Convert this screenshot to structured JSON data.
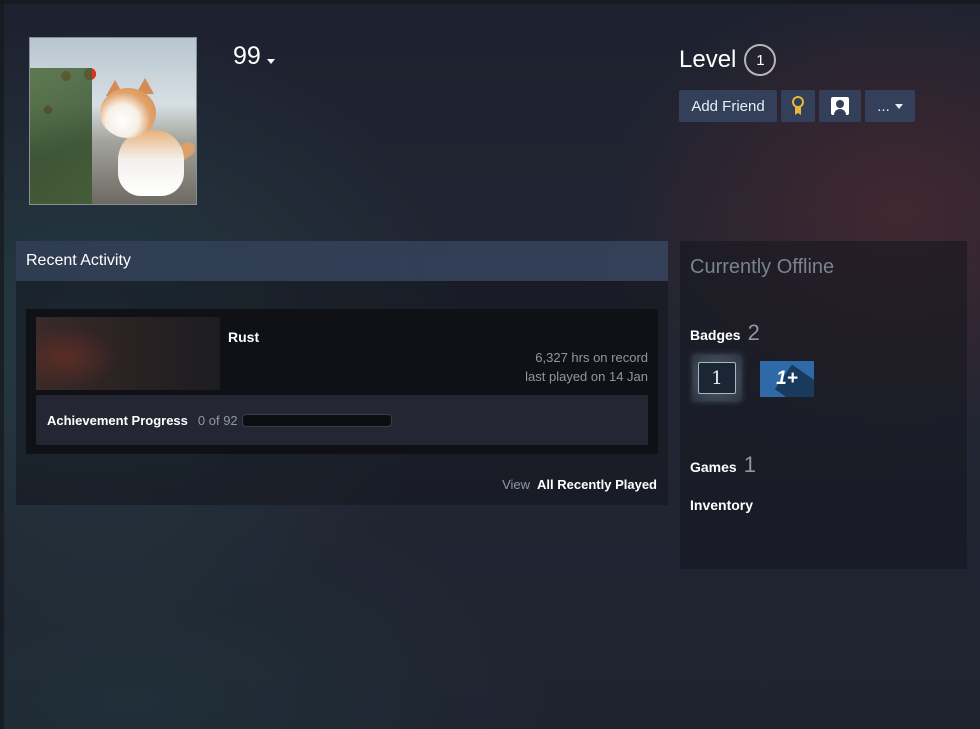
{
  "profile": {
    "persona_name": "99",
    "level_label": "Level",
    "level_value": "1"
  },
  "actions": {
    "add_friend": "Add Friend",
    "more": "..."
  },
  "recent_activity": {
    "title": "Recent Activity",
    "game": {
      "name": "Rust",
      "hours": "6,327 hrs on record",
      "last_played": "last played on 14 Jan",
      "achievement_label": "Achievement Progress",
      "achievement_count": "0 of 92",
      "achievement_fraction": 0
    },
    "view_label": "View",
    "view_all_label": "All Recently Played"
  },
  "sidebar": {
    "status": "Currently Offline",
    "badges_label": "Badges",
    "badges_count": "2",
    "badge1_text": "1",
    "badge2_text": "1+",
    "games_label": "Games",
    "games_count": "1",
    "inventory_label": "Inventory"
  },
  "icons": {
    "persona_menu": "chevron-down-icon",
    "badge_button": "ribbon-icon",
    "profile_button": "person-icon",
    "more_menu": "chevron-down-icon"
  },
  "colors": {
    "accent_button": "#34405a",
    "award_gold": "#e6b53a",
    "badge_blue": "#2f6aa8"
  }
}
